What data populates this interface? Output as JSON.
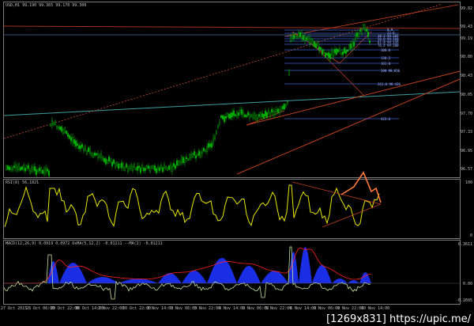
{
  "main_pane": {
    "header": "USD,H1  99.190 99.365 99.170 99.300",
    "price_scale": [
      "99.82",
      "99.43",
      "99.19",
      "98.80",
      "98.43",
      "98.05",
      "97.70",
      "97.33",
      "96.95",
      "96.57"
    ],
    "fib_labels": [
      "0.0",
      "23.6",
      "38.2 99.185",
      "50.0 99.160",
      "61.8 99.145",
      "76.4 99.100",
      "100.0",
      "138.2",
      "161.8",
      "200 98.650",
      "261.8 98.420",
      "423.6"
    ]
  },
  "rsi_pane": {
    "header": "RSI(8) 56.1821",
    "scale": [
      "100",
      "0"
    ]
  },
  "macd_pane": {
    "header": "MACD(12,26,9) 0.0919 0.0972   OsMA(5,12,2) -0.01211   --MA(2) -0.01211",
    "scale": [
      "0.3611",
      "0.00",
      "-0.2695"
    ]
  },
  "x_axis": [
    "27 Oct 2015",
    "28 Oct 06:00",
    "29 Oct 22:00",
    "30 Oct 14:00",
    "2 Nov 22:00",
    "30 Oct 22:00",
    "2 Nov 14:00",
    "3 Nov 06:00",
    "3 Nov 22:00",
    "4 Nov 14:00",
    "5 Nov 06:00",
    "5 Nov 22:00",
    "6 Nov 14:00",
    "9 Nov 06:00",
    "9 Nov 22:00",
    "10 Nov 14:00"
  ],
  "watermark": "[1269x831] https://upic.me/",
  "colors": {
    "background": "#000000",
    "candles": "#00c800",
    "rsi_line": "#e8e800",
    "macd_histogram": "#1a2ee6",
    "macd_signal": "#ff2020",
    "osma_line": "#c8e6a0",
    "trendline_cyan": "#3fa0a0",
    "trendline_red": "#a03020",
    "fib": "#4060d0",
    "annotation": "#ff7a3a"
  }
}
